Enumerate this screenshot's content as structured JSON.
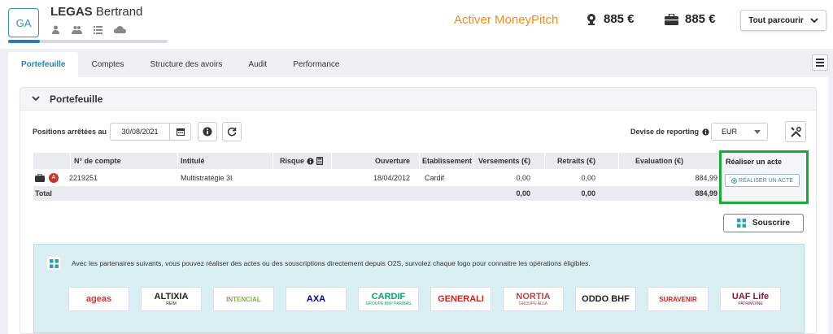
{
  "client": {
    "initials": "GA",
    "last_name": "LEGAS",
    "first_name": "Bertrand",
    "progress_fraction": 0.2
  },
  "header": {
    "moneypitch_link": "Activer MoneyPitch",
    "amount1": "885 €",
    "amount2": "885 €",
    "tout_parcourir": "Tout parcourir"
  },
  "tabs": [
    {
      "label": "Portefeuille",
      "active": true
    },
    {
      "label": "Comptes"
    },
    {
      "label": "Structure des avoirs"
    },
    {
      "label": "Audit"
    },
    {
      "label": "Performance"
    }
  ],
  "section": {
    "title": "Portefeuille",
    "positions_label": "Positions arrêtées au",
    "date_value": "30/08/2021",
    "devise_label": "Devise de reporting",
    "devise_value": "EUR"
  },
  "table": {
    "headers": {
      "compte": "N° de compte",
      "intitule": "Intitulé",
      "risque": "Risque",
      "ouverture": "Ouverture",
      "etablissement": "Etablissement",
      "versements": "Versements (€)",
      "retraits": "Retraits (€)",
      "evaluation": "Evaluation (€)",
      "acte": "Réaliser un acte"
    },
    "row": {
      "compte": "2219251",
      "intitule": "Multistratégie 3I",
      "ouverture": "18/04/2012",
      "etablissement": "Cardif",
      "versements": "0,00",
      "retraits": "0,00",
      "evaluation": "884,99",
      "badge": "A",
      "acte_button": "RÉALISER UN ACTE"
    },
    "total": {
      "label": "Total",
      "versements": "0,00",
      "retraits": "0,00",
      "evaluation": "884,99"
    }
  },
  "souscrire_button": "Souscrire",
  "partners": {
    "text": "Avec les partenaires suivants, vous pouvez réaliser des actes ou des souscriptions directement depuis O2S, survolez chaque logo pour connaitre les opérations éligibles.",
    "logos": [
      {
        "name": "ageas",
        "color": "#d33"
      },
      {
        "name": "ALTIXIA",
        "sub": "REIM",
        "color": "#222"
      },
      {
        "name": "INTENCIAL",
        "color": "#8a5"
      },
      {
        "name": "AXA",
        "color": "#00008f"
      },
      {
        "name": "CARDIF",
        "sub": "GROUPE BNP PARIBAS",
        "color": "#0a6"
      },
      {
        "name": "GENERALI",
        "color": "#c22"
      },
      {
        "name": "NORTIA",
        "sub": "GROUPE ALLA",
        "color": "#b44"
      },
      {
        "name": "ODDO BHF",
        "color": "#222"
      },
      {
        "name": "SURAVENIR",
        "color": "#c22"
      },
      {
        "name": "UAF Life",
        "sub": "PATRIMOINE",
        "color": "#8a1538"
      }
    ]
  }
}
